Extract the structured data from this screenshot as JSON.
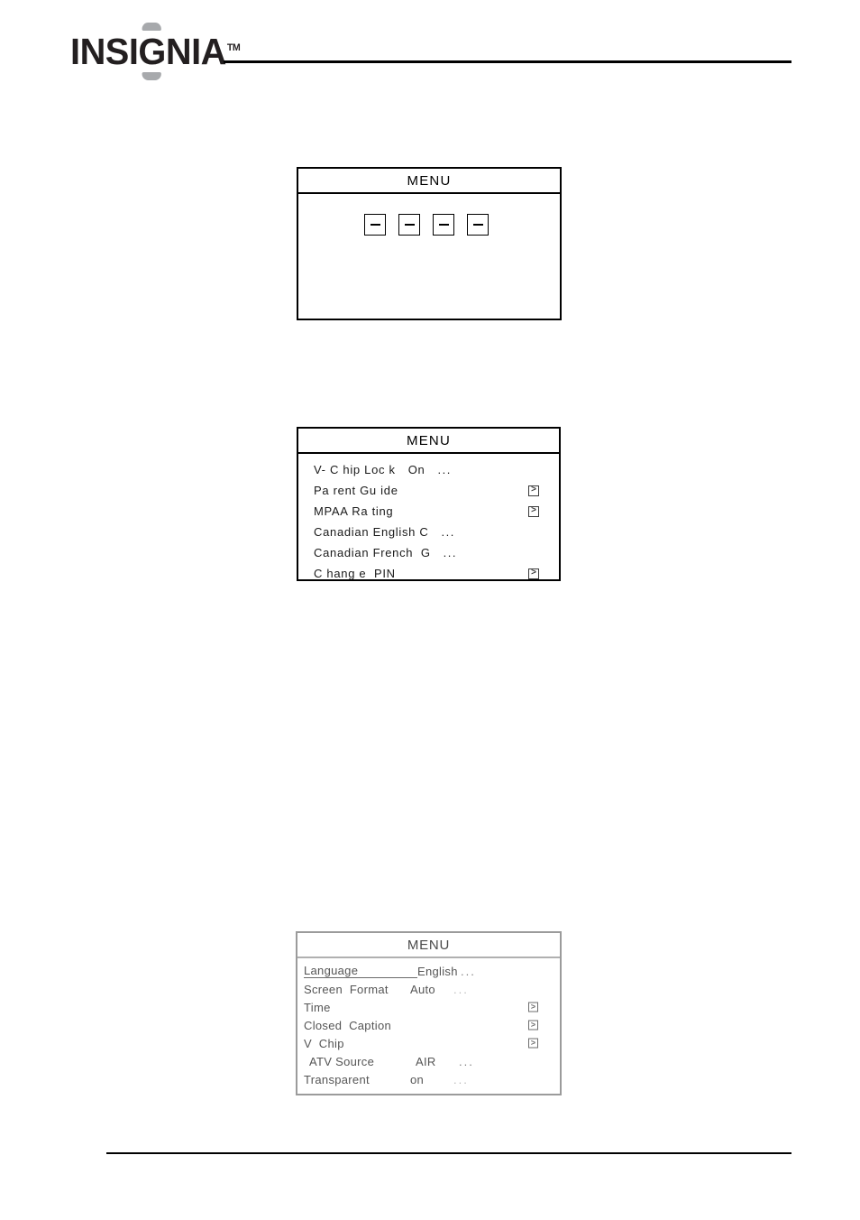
{
  "header": {
    "brand_part1": "INSI",
    "brand_g": "G",
    "brand_part2": "NIA",
    "trademark": "TM"
  },
  "osd_menu_top": {
    "title": "MENU",
    "tab_icons": [
      {
        "name": "tab-icon-1",
        "glyph": "dash"
      },
      {
        "name": "tab-icon-2",
        "glyph": "dash"
      },
      {
        "name": "tab-icon-3",
        "glyph": "dash"
      },
      {
        "name": "tab-icon-4",
        "glyph": "dash"
      }
    ]
  },
  "osd_menu_vchip": {
    "title": "MENU",
    "rows": [
      {
        "label": "V- C hip Loc k",
        "value": "On",
        "dots": "...",
        "arrow": ""
      },
      {
        "label": "Pa rent Gu ide",
        "value": "",
        "dots": "",
        "arrow": ">"
      },
      {
        "label": "MPAA Ra ting",
        "value": "",
        "dots": "",
        "arrow": ">"
      },
      {
        "label": "Canadian English C",
        "value": "",
        "dots": "...",
        "arrow": ""
      },
      {
        "label": "Canadian French  G",
        "value": "",
        "dots": "...",
        "arrow": ""
      },
      {
        "label": "C hang e  PIN",
        "value": "",
        "dots": "",
        "arrow": ">"
      }
    ]
  },
  "osd_menu_setup": {
    "title": "MENU",
    "rows": [
      {
        "label": "Language",
        "value": "English",
        "dots": "...",
        "arrow": ""
      },
      {
        "label": "Screen  Format",
        "value": "Auto",
        "dots": "...",
        "arrow": ""
      },
      {
        "label": "Time",
        "value": "",
        "dots": "",
        "arrow": ">"
      },
      {
        "label": "Closed  Caption",
        "value": "",
        "dots": "",
        "arrow": ">"
      },
      {
        "label": "V  Chip",
        "value": "",
        "dots": "",
        "arrow": ">"
      },
      {
        "label": "ATV Source",
        "value": "AIR",
        "dots": "...",
        "arrow": ""
      },
      {
        "label": "Transparent",
        "value": "on",
        "dots": "...",
        "arrow": ""
      }
    ]
  },
  "colors": {
    "ink": "#000000",
    "logo_dark": "#231f20",
    "logo_gray": "#a7a9ac",
    "scan_gray": "#555555"
  }
}
